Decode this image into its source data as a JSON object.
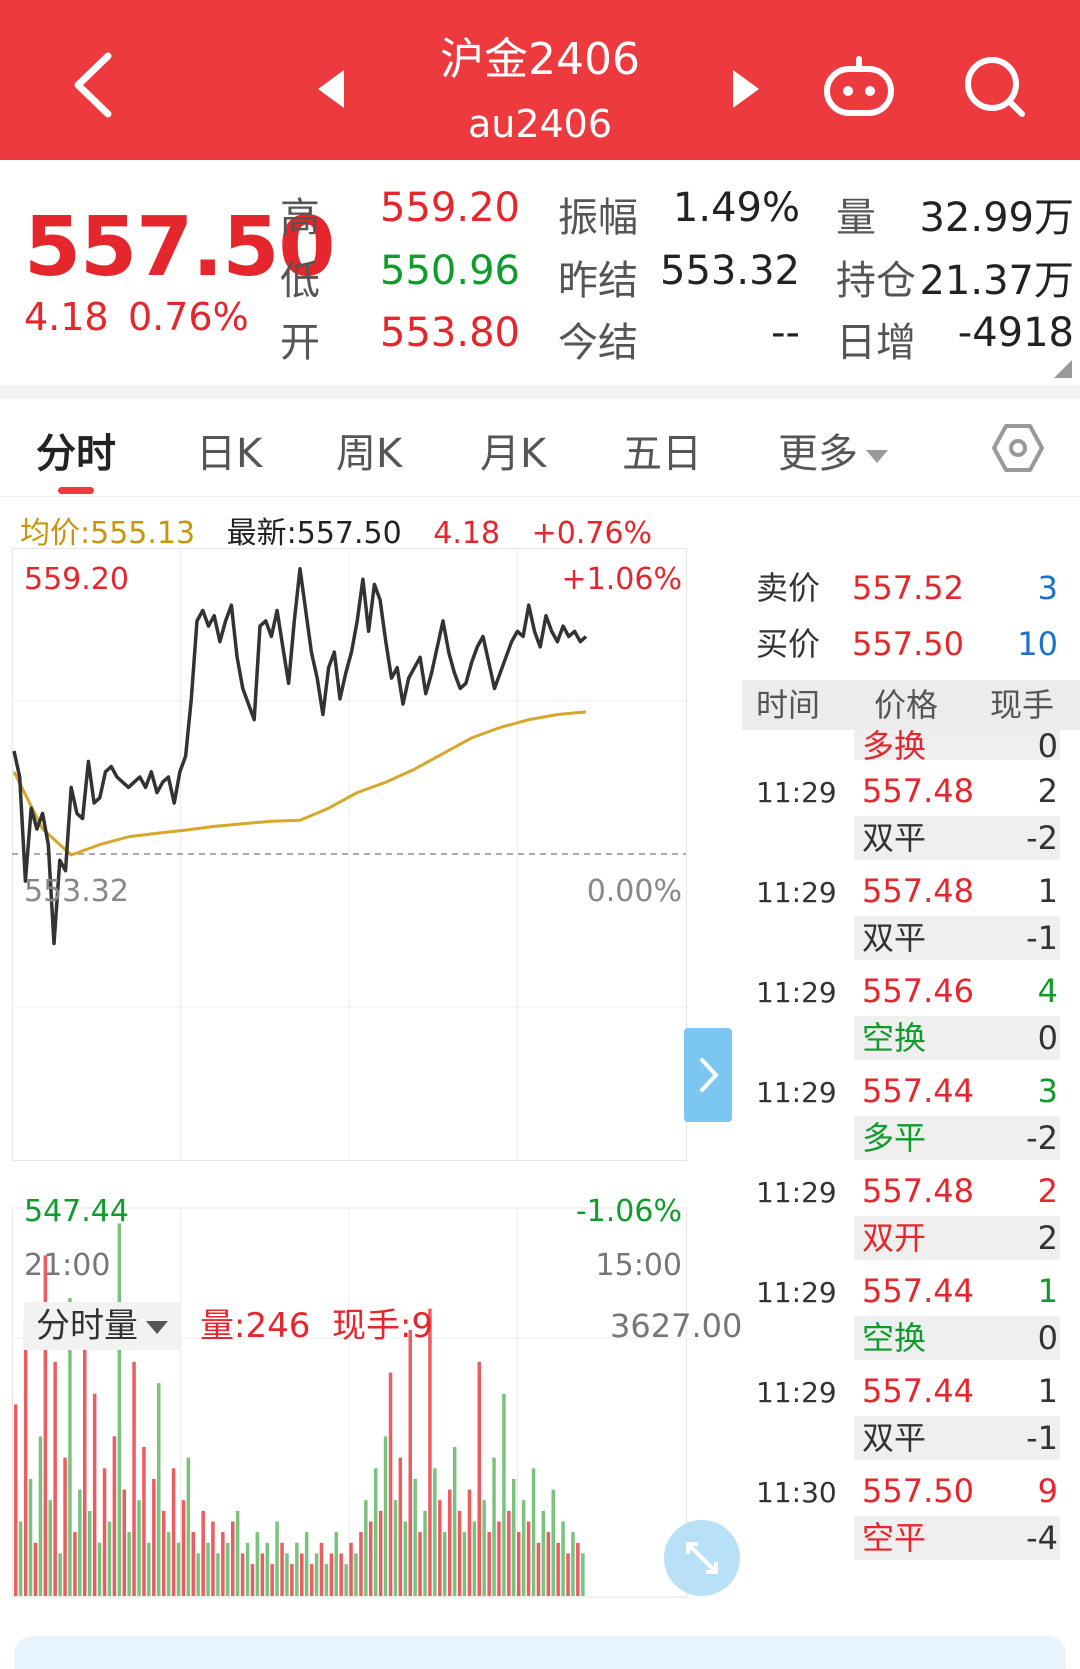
{
  "header": {
    "title": "沪金2406",
    "code": "au2406",
    "colors": {
      "background": "#ec3a3f"
    }
  },
  "quote": {
    "last": "557.50",
    "change": "4.18",
    "change_pct": "0.76%",
    "stats": [
      {
        "label": "高",
        "value": "559.20",
        "color": "red"
      },
      {
        "label": "低",
        "value": "550.96",
        "color": "green"
      },
      {
        "label": "开",
        "value": "553.80",
        "color": "red"
      },
      {
        "label": "振幅",
        "value": "1.49%",
        "color": "dark"
      },
      {
        "label": "昨结",
        "value": "553.32",
        "color": "dark"
      },
      {
        "label": "今结",
        "value": "--",
        "color": "dark"
      },
      {
        "label": "量",
        "value": "32.99万",
        "color": "dark"
      },
      {
        "label": "持仓",
        "value": "21.37万",
        "color": "dark"
      },
      {
        "label": "日增",
        "value": "-4918",
        "color": "dark"
      }
    ]
  },
  "tabs": [
    {
      "label": "分时",
      "active": true
    },
    {
      "label": "日K",
      "active": false
    },
    {
      "label": "周K",
      "active": false
    },
    {
      "label": "月K",
      "active": false
    },
    {
      "label": "五日",
      "active": false
    },
    {
      "label": "更多",
      "active": false
    }
  ],
  "info": {
    "avg": "均价:555.13",
    "latest": "最新:557.50",
    "change": "4.18",
    "change_pct": "+0.76%"
  },
  "chart_data": {
    "type": "line",
    "x_start_label": "21:00",
    "x_end_label": "15:00",
    "y_max_label": "559.20",
    "y_min_label": "547.44",
    "y_ref_label": "553.32",
    "pct_max_label": "+1.06%",
    "pct_zero_label": "0.00%",
    "pct_min_label": "-1.06%",
    "ylim": [
      547.44,
      559.2
    ],
    "reference": 553.32,
    "x_range": [
      0,
      100
    ],
    "series": [
      {
        "role": "price",
        "color": "#333333",
        "x": [
          0,
          1,
          2,
          3,
          4,
          5,
          6,
          7,
          8,
          9,
          10,
          11,
          12,
          13,
          14,
          15,
          16,
          17,
          18,
          19,
          20,
          21,
          22,
          23,
          24,
          25,
          26,
          27,
          28,
          29,
          30,
          31,
          32,
          33,
          34,
          35,
          36,
          37,
          38,
          39,
          40,
          41,
          42,
          43,
          44,
          45,
          46,
          47,
          48,
          49,
          50,
          51,
          52,
          53,
          54,
          55,
          56,
          57,
          58,
          59,
          60,
          61,
          62,
          63,
          64,
          65,
          66,
          67,
          68,
          69,
          70,
          71,
          72,
          73,
          74,
          75,
          76,
          77,
          78,
          79,
          80,
          81,
          82,
          83,
          84,
          85,
          86,
          87,
          88,
          89,
          90,
          91,
          92,
          93,
          94,
          95,
          96,
          97,
          98,
          99,
          100
        ],
        "values": [
          555.3,
          554.8,
          552.8,
          554.2,
          553.8,
          554.1,
          553.5,
          551.6,
          553.2,
          553.0,
          554.6,
          554.1,
          554.0,
          555.1,
          554.3,
          554.4,
          554.9,
          555.0,
          554.8,
          554.7,
          554.6,
          554.7,
          554.8,
          554.6,
          554.9,
          554.5,
          554.7,
          554.8,
          554.3,
          554.9,
          555.2,
          556.3,
          557.8,
          558.0,
          557.7,
          557.9,
          557.4,
          557.8,
          558.1,
          557.1,
          556.5,
          556.2,
          555.9,
          557.7,
          557.8,
          557.5,
          558.0,
          557.3,
          556.6,
          557.8,
          558.8,
          558.0,
          557.2,
          556.7,
          556.0,
          556.9,
          557.2,
          556.3,
          556.8,
          557.2,
          557.8,
          558.6,
          557.6,
          558.5,
          558.2,
          557.4,
          556.7,
          556.9,
          556.2,
          556.7,
          556.9,
          557.1,
          556.4,
          556.8,
          557.3,
          557.8,
          557.2,
          556.8,
          556.5,
          556.6,
          557.0,
          557.3,
          557.5,
          557.0,
          556.5,
          556.8,
          557.1,
          557.4,
          557.6,
          557.5,
          558.1,
          557.6,
          557.3,
          557.9,
          557.6,
          557.4,
          557.7,
          557.5,
          557.6,
          557.4,
          557.5
        ]
      },
      {
        "role": "average",
        "color": "#d9a62c",
        "x": [
          0,
          5,
          10,
          15,
          20,
          25,
          30,
          35,
          40,
          45,
          50,
          55,
          60,
          65,
          70,
          75,
          80,
          85,
          90,
          95,
          100
        ],
        "values": [
          554.9,
          553.8,
          553.3,
          553.5,
          553.65,
          553.72,
          553.78,
          553.85,
          553.9,
          553.95,
          553.97,
          554.2,
          554.5,
          554.7,
          554.95,
          555.25,
          555.55,
          555.75,
          555.9,
          556.0,
          556.05
        ]
      }
    ],
    "volume": {
      "label": "分时量",
      "current": "量:246",
      "hand": "现手:9",
      "max_label": "3627.00",
      "ylim": [
        0,
        3627
      ],
      "values": [
        1800,
        700,
        2600,
        1100,
        500,
        1500,
        3200,
        900,
        2200,
        400,
        1300,
        2800,
        600,
        1000,
        2400,
        800,
        1900,
        500,
        1200,
        700,
        1500,
        3500,
        1000,
        600,
        2200,
        900,
        1400,
        500,
        1100,
        2000,
        800,
        600,
        1200,
        500,
        900,
        1300,
        600,
        400,
        800,
        500,
        700,
        400,
        600,
        500,
        700,
        800,
        400,
        500,
        300,
        600,
        400,
        500,
        300,
        700,
        500,
        400,
        300,
        500,
        400,
        600,
        300,
        400,
        500,
        300,
        400,
        600,
        400,
        300,
        500,
        400,
        600,
        900,
        700,
        1200,
        800,
        1500,
        2100,
        900,
        1300,
        700,
        2500,
        1100,
        600,
        800,
        2700,
        1200,
        900,
        600,
        1000,
        1400,
        800,
        600,
        1000,
        700,
        2200,
        900,
        600,
        1300,
        700,
        1900,
        800,
        1100,
        600,
        900,
        700,
        1200,
        500,
        800,
        600,
        1000,
        500,
        700,
        400,
        600,
        500,
        400
      ]
    }
  },
  "book": {
    "ask_label": "卖价",
    "ask_price": "557.52",
    "ask_vol": "3",
    "bid_label": "买价",
    "bid_price": "557.50",
    "bid_vol": "10"
  },
  "ticks_header": {
    "time": "时间",
    "price": "价格",
    "hand": "现手",
    "partial_type": "多换",
    "partial_oi": "0"
  },
  "ticks": [
    {
      "time": "11:29",
      "price": "557.48",
      "vol": "2",
      "vol_color": "dark",
      "type": "双平",
      "type_color": "dark",
      "oi": "-2"
    },
    {
      "time": "11:29",
      "price": "557.48",
      "vol": "1",
      "vol_color": "dark",
      "type": "双平",
      "type_color": "dark",
      "oi": "-1"
    },
    {
      "time": "11:29",
      "price": "557.46",
      "vol": "4",
      "vol_color": "green",
      "type": "空换",
      "type_color": "green",
      "oi": "0"
    },
    {
      "time": "11:29",
      "price": "557.44",
      "vol": "3",
      "vol_color": "green",
      "type": "多平",
      "type_color": "green",
      "oi": "-2"
    },
    {
      "time": "11:29",
      "price": "557.48",
      "vol": "2",
      "vol_color": "red",
      "type": "双开",
      "type_color": "red",
      "oi": "2"
    },
    {
      "time": "11:29",
      "price": "557.44",
      "vol": "1",
      "vol_color": "green",
      "type": "空换",
      "type_color": "green",
      "oi": "0"
    },
    {
      "time": "11:29",
      "price": "557.44",
      "vol": "1",
      "vol_color": "dark",
      "type": "双平",
      "type_color": "dark",
      "oi": "-1"
    },
    {
      "time": "11:30",
      "price": "557.50",
      "vol": "9",
      "vol_color": "red",
      "type": "空平",
      "type_color": "red",
      "oi": "-4"
    }
  ],
  "icons": [
    "back-icon",
    "prev-contract-icon",
    "next-contract-icon",
    "robot-icon",
    "search-icon",
    "settings-icon",
    "expand-icon",
    "chevron-right-icon"
  ]
}
